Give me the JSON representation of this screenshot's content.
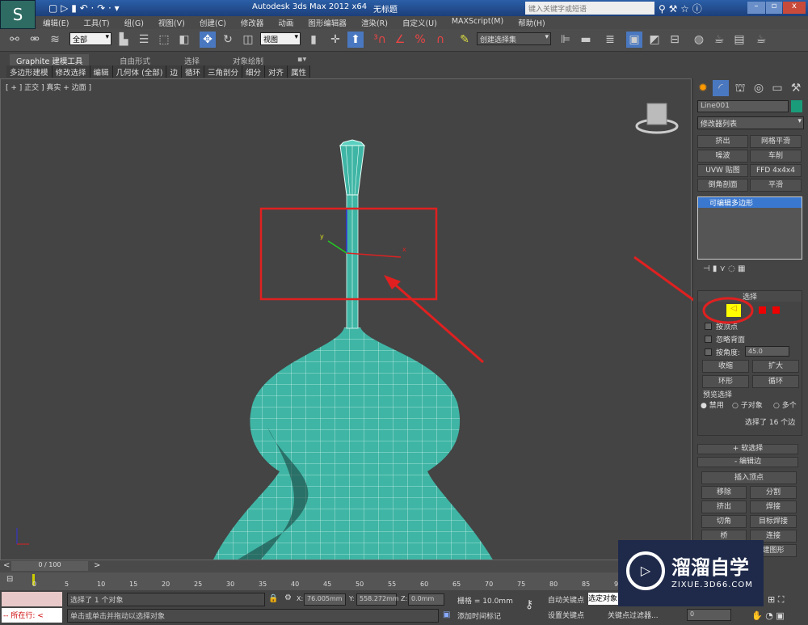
{
  "title": {
    "app": "Autodesk 3ds Max  2012 x64",
    "doc": "无标题",
    "search_placeholder": "键入关键字或短语"
  },
  "menu": [
    "编辑(E)",
    "工具(T)",
    "组(G)",
    "视图(V)",
    "创建(C)",
    "修改器",
    "动画",
    "图形编辑器",
    "渲染(R)",
    "自定义(U)",
    "MAXScript(M)",
    "帮助(H)"
  ],
  "toolbar": {
    "selection_filter": "全部",
    "ref_coord": "视图",
    "named_sel": "创建选择集"
  },
  "ribbon": {
    "tabs": [
      "Graphite 建模工具",
      "自由形式",
      "选择",
      "对象绘制"
    ],
    "subtabs": [
      "多边形建模",
      "修改选择",
      "编辑",
      "几何体 (全部)",
      "边",
      "循环",
      "三角剖分",
      "细分",
      "对齐",
      "属性"
    ]
  },
  "viewport": {
    "label": "[ + ] 正交 ] 真实 + 边面 ]",
    "object_color": "#3fb5a5",
    "highlight_color": "#e02020"
  },
  "cmd": {
    "object_name": "Line001",
    "object_color": "#1a9c7a",
    "modifier_list": "修改器列表",
    "mod_buttons": [
      "挤出",
      "网格平滑",
      "噪波",
      "车削",
      "UVW 贴图",
      "FFD 4x4x4",
      "倒角剖面",
      "平滑"
    ],
    "stack_item": "可编辑多边形",
    "rollout_select": "选择",
    "by_vertex": "按顶点",
    "ignore_backfacing": "忽略背面",
    "by_angle": "按角度:",
    "angle_value": "45.0",
    "shrink": "收缩",
    "grow": "扩大",
    "ring": "环形",
    "loop": "循环",
    "preview": "预览选择",
    "preview_opts": [
      "禁用",
      "子对象",
      "多个"
    ],
    "sel_info": "选择了 16 个边",
    "soft_sel": "软选择",
    "edit_edges": "编辑边",
    "edge_buttons": [
      "插入顶点",
      "移除",
      "分割",
      "挤出",
      "焊接",
      "切角",
      "目标焊接",
      "桥",
      "连接"
    ],
    "create_shape": "建图形"
  },
  "timeline": {
    "frame": "0 / 100",
    "ticks": [
      "0",
      "5",
      "10",
      "15",
      "20",
      "25",
      "30",
      "35",
      "40",
      "45",
      "50",
      "55",
      "60",
      "65",
      "70",
      "75",
      "80",
      "85",
      "90"
    ]
  },
  "status": {
    "selected": "选择了 1 个对象",
    "prompt": "单击或单击并拖动以选择对象",
    "x": "76.005mm",
    "y": "558.272mm",
    "z": "0.0mm",
    "grid": "栅格 = 10.0mm",
    "add_tag": "添加时间标记",
    "auto_key": "自动关键点",
    "set_key": "设置关键点",
    "sel_obj": "选定对象",
    "key_filter": "关键点过滤器...",
    "frame_val": "0",
    "script": "-- 所在行: <",
    "x_label": "X:",
    "y_label": "Y:",
    "z_label": "Z:"
  },
  "watermark": {
    "name": "溜溜自学",
    "url": "ZIXUE.3D66.COM"
  }
}
